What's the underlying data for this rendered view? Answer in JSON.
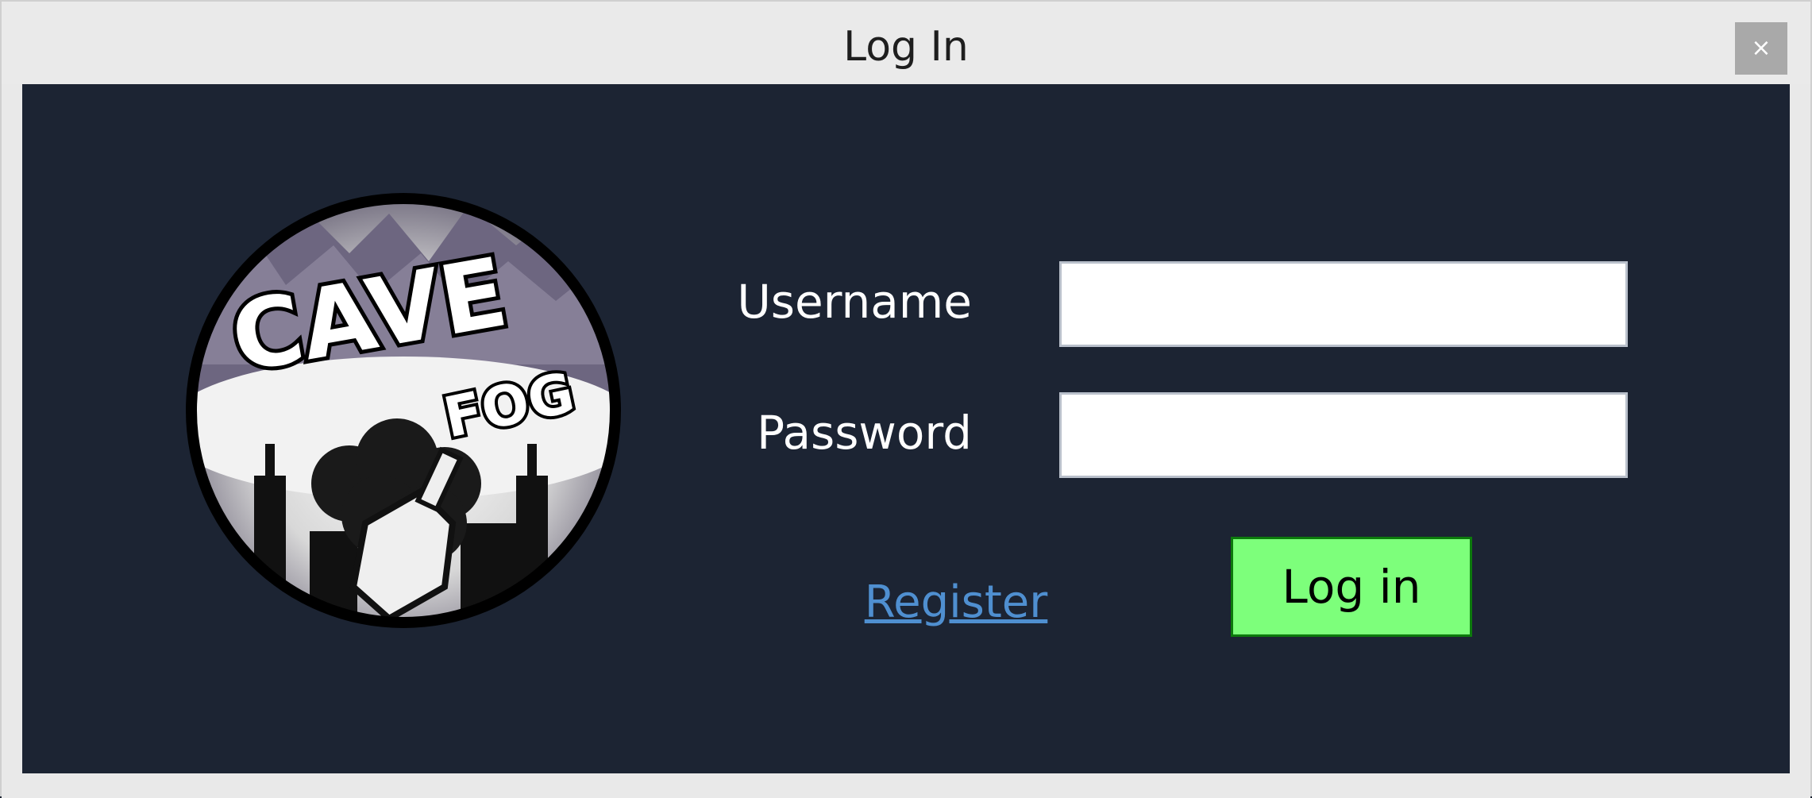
{
  "window": {
    "title": "Log In",
    "close_label": "×"
  },
  "logo": {
    "icon": "cave-fog-logo",
    "text_line1": "CAVE",
    "text_line2": "FOG"
  },
  "form": {
    "username_label": "Username",
    "username_value": "",
    "username_placeholder": "",
    "password_label": "Password",
    "password_value": "",
    "password_placeholder": ""
  },
  "actions": {
    "register_label": "Register",
    "login_label": "Log in"
  },
  "colors": {
    "background": "#1c2433",
    "login_button": "#7dff7b",
    "link": "#4f8fd0"
  }
}
